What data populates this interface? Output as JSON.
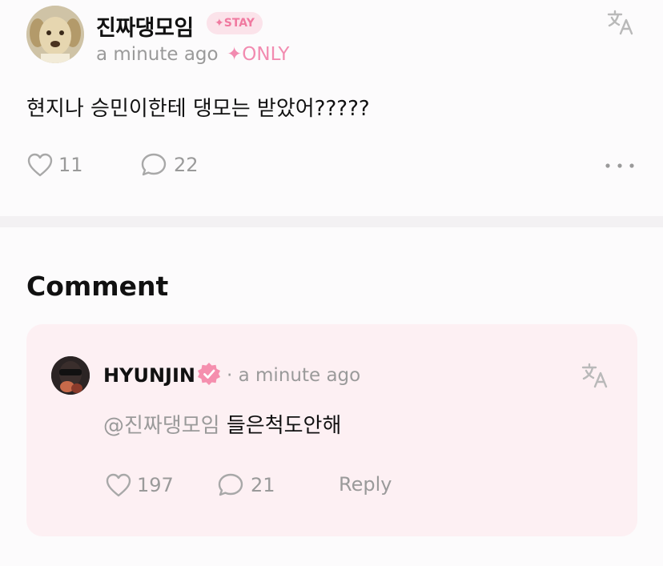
{
  "post": {
    "author": "진짜댕모임",
    "badge": "✦STAY",
    "time": "a minute ago",
    "only_tag": "✦ONLY",
    "text": "현지나 승민이한테 댕모는 받았어?????",
    "likes": "11",
    "comments": "22",
    "icons": {
      "translate": "translate-icon",
      "like": "heart-icon",
      "comment": "speech-bubble-icon",
      "more": "more-dots-icon"
    }
  },
  "comments_section": {
    "title": "Comment"
  },
  "comment": {
    "author": "HYUNJIN",
    "time": "· a minute ago",
    "mention": "@진짜댕모임",
    "text": "들은척도안해",
    "likes": "197",
    "replies": "21",
    "reply_label": "Reply",
    "icons": {
      "verified": "verified-badge-icon",
      "translate": "translate-icon"
    }
  },
  "colors": {
    "accent_pink": "#f28bb0",
    "badge_bg": "#fbe3ea",
    "card_bg": "#fdf0f3",
    "muted": "#9a9a9a"
  }
}
